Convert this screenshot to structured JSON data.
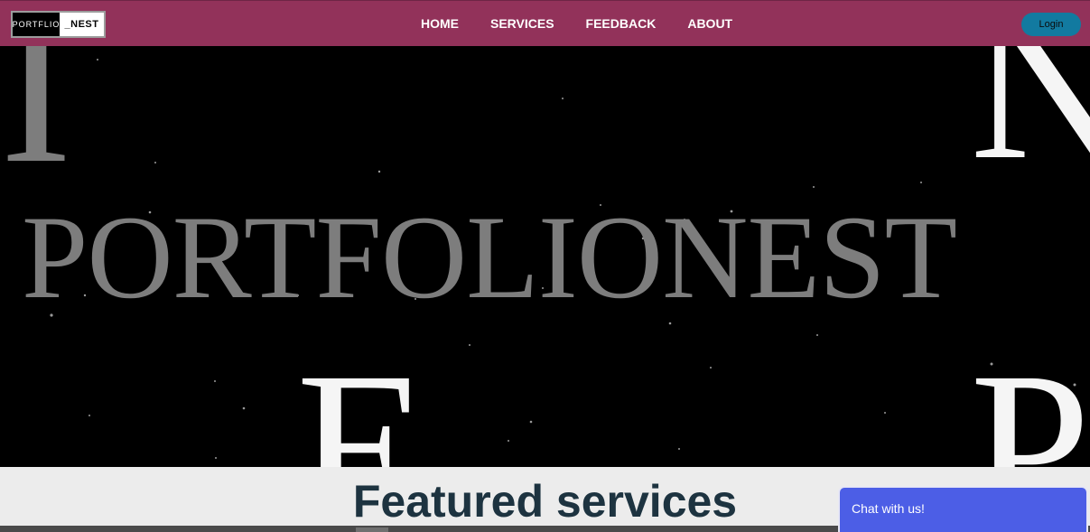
{
  "header": {
    "logo": {
      "left_text": "PORTFLIO",
      "right_text": "_NEST"
    },
    "nav": [
      {
        "label": "HOME"
      },
      {
        "label": "SERVICES"
      },
      {
        "label": "FEEDBACK"
      },
      {
        "label": "ABOUT"
      }
    ],
    "login_label": "Login"
  },
  "hero": {
    "title": "PORTFOLIONEST",
    "letters": [
      "I",
      "N",
      "E",
      "P"
    ]
  },
  "featured": {
    "title": "Featured services"
  },
  "chat": {
    "label": "Chat with us!"
  },
  "colors": {
    "navbar": "#92325a",
    "login": "#127aa0",
    "hero_bg": "#000000",
    "hero_text": "#7d7d7d",
    "chat": "#4c5ee6",
    "featured_text": "#1d3340"
  }
}
